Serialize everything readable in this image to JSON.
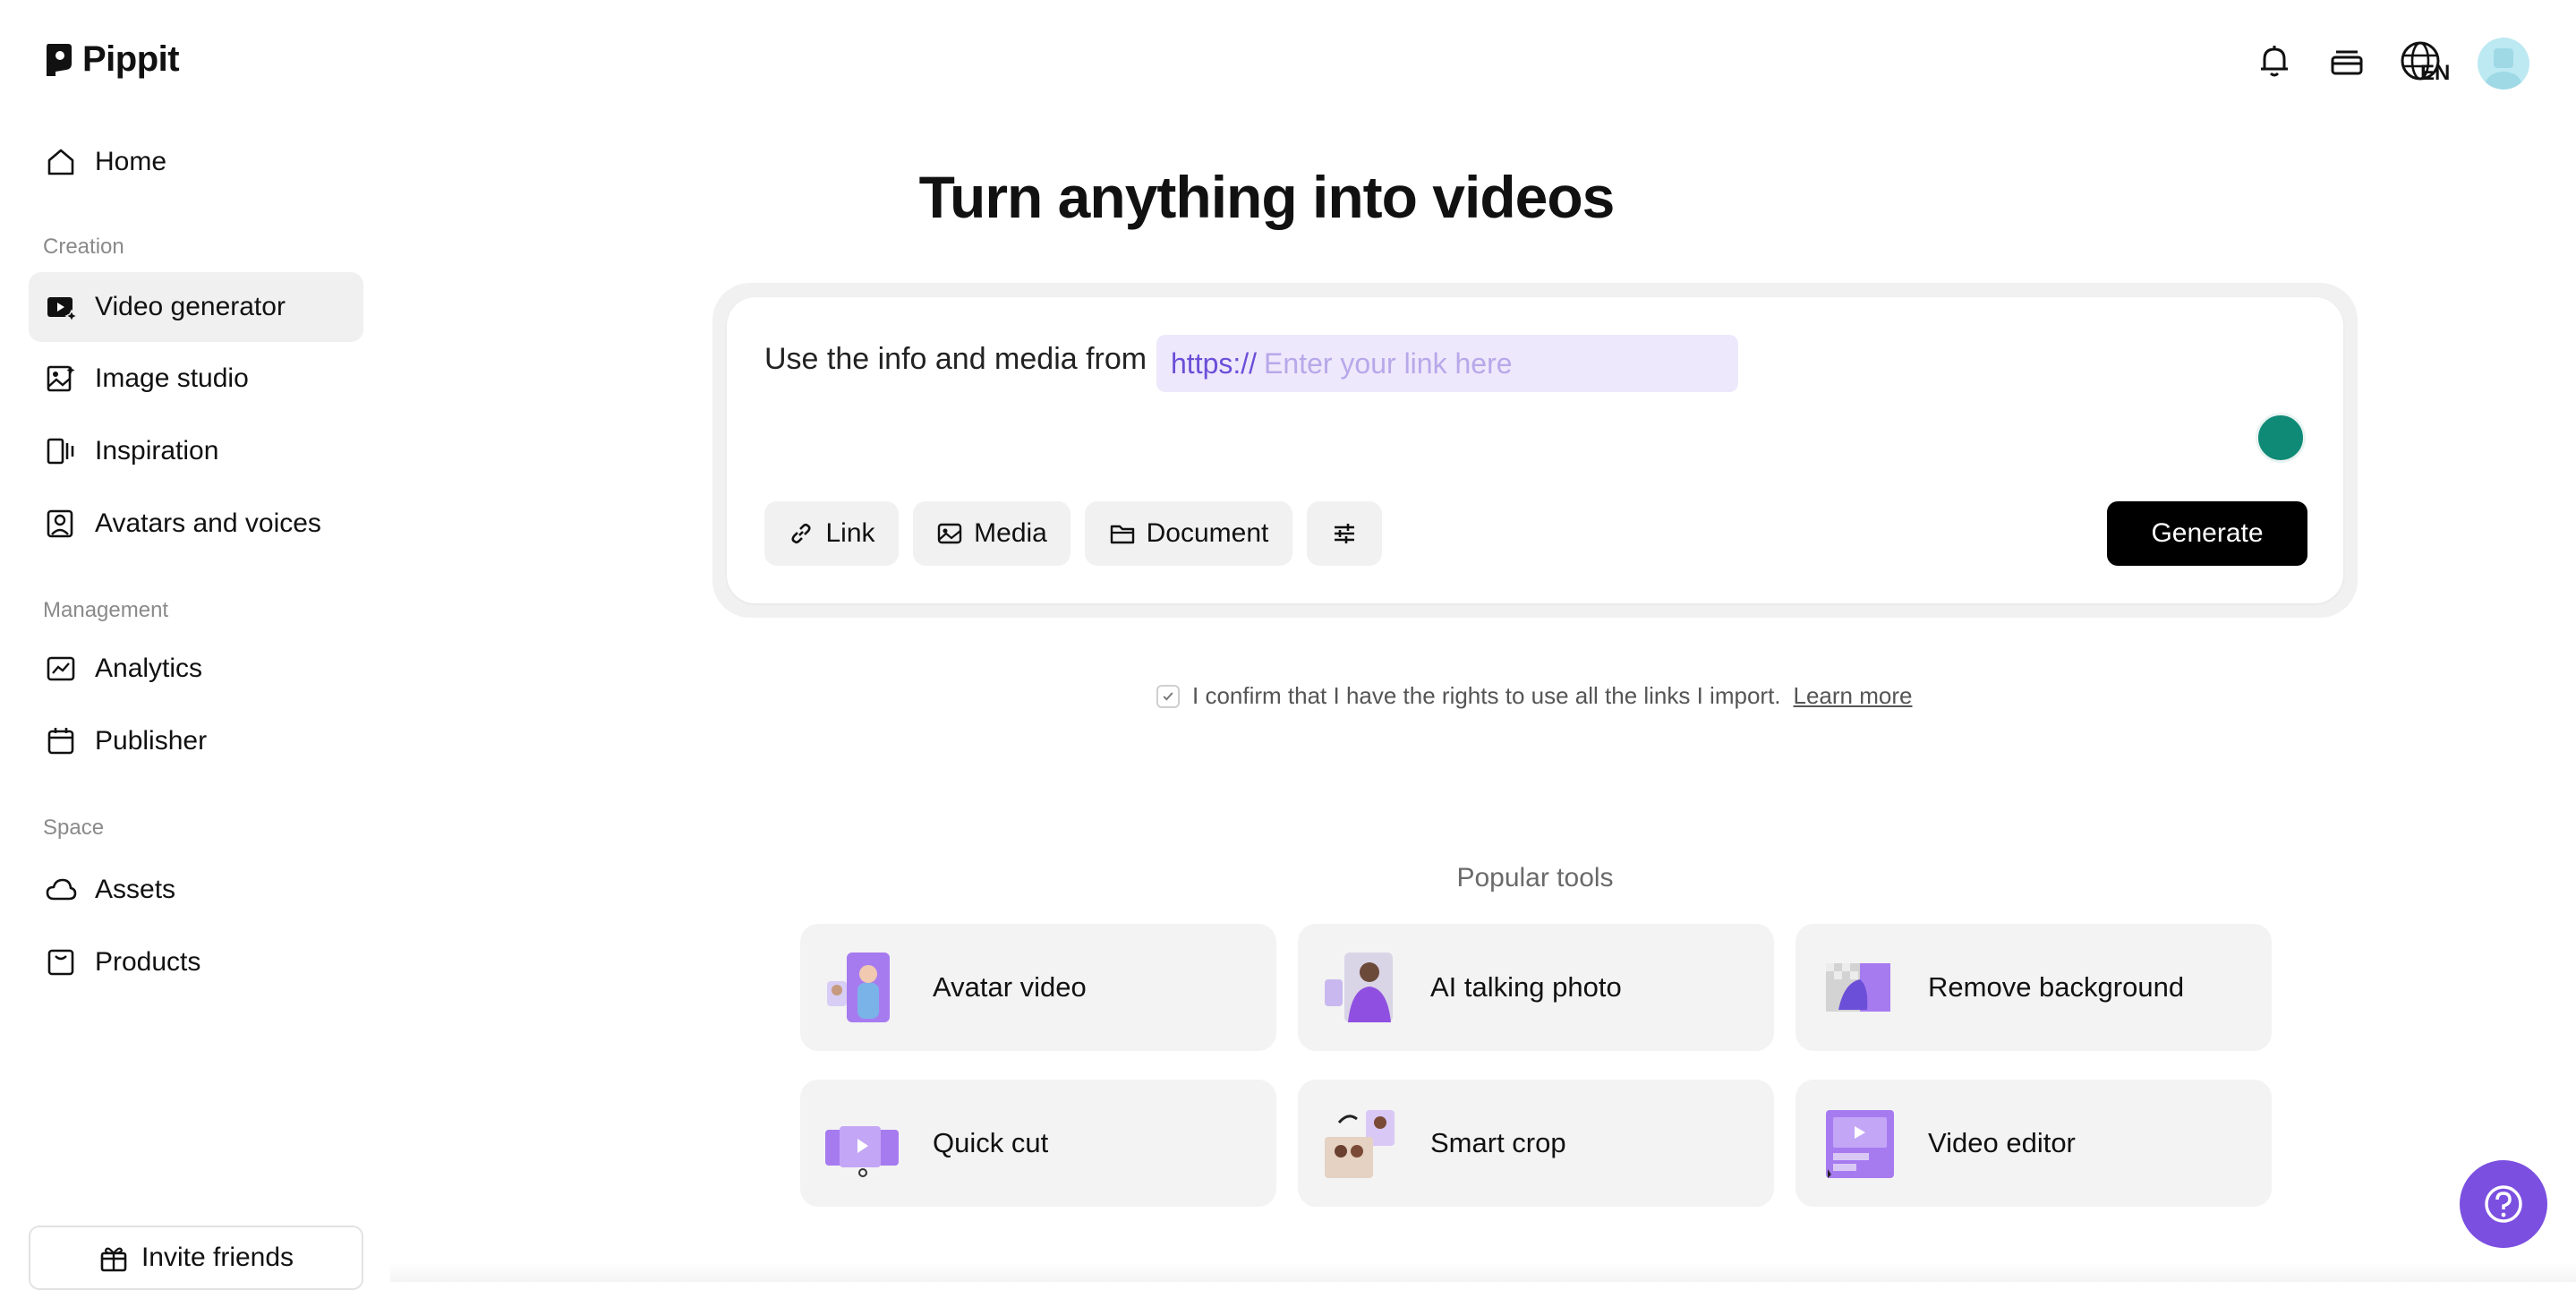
{
  "app": {
    "name": "Pippit"
  },
  "sidebar": {
    "home": "Home",
    "sections": [
      {
        "label": "Creation",
        "items": [
          "Video generator",
          "Image studio",
          "Inspiration",
          "Avatars and voices"
        ]
      },
      {
        "label": "Management",
        "items": [
          "Analytics",
          "Publisher"
        ]
      },
      {
        "label": "Space",
        "items": [
          "Assets",
          "Products"
        ]
      }
    ],
    "active_item": "Video generator",
    "invite": "Invite friends"
  },
  "topbar": {
    "language": "EN",
    "icons": [
      "bell-icon",
      "layers-icon",
      "globe-icon",
      "avatar"
    ]
  },
  "main": {
    "headline": "Turn anything into videos",
    "prompt_label": "Use the info and media from",
    "link_prefix": "https://",
    "link_placeholder": "Enter your link here",
    "buttons": {
      "link": "Link",
      "media": "Media",
      "document": "Document",
      "generate": "Generate"
    },
    "confirm_text": "I confirm that I have the rights to use all the links I import.",
    "learn_more": "Learn more",
    "popular_title": "Popular tools",
    "tools": [
      "Avatar video",
      "AI talking photo",
      "Remove background",
      "Quick cut",
      "Smart crop",
      "Video editor"
    ]
  },
  "colors": {
    "accent": "#7b4fe0",
    "link_bg": "#ede8fb",
    "primary_button": "#000000"
  }
}
